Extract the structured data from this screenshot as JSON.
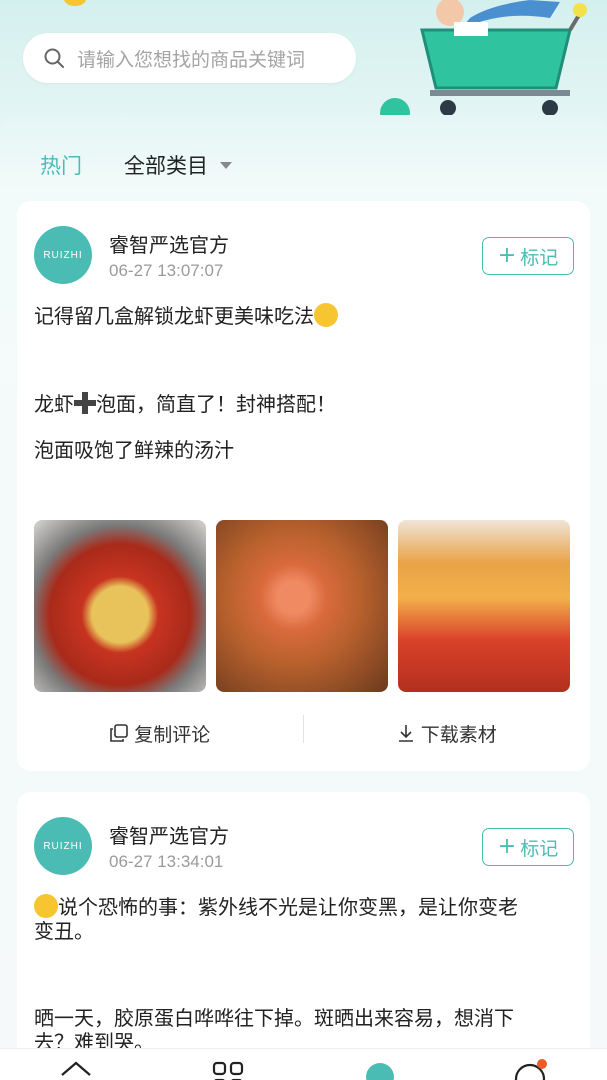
{
  "search": {
    "placeholder": "请输入您想找的商品关键词"
  },
  "tabs": {
    "hot": "热门",
    "category": "全部类目"
  },
  "posts": [
    {
      "author": "睿智严选官方",
      "avatar_text": "RUIZHI",
      "time": "06-27 13:07:07",
      "mark_label": "标记",
      "lines": [
        "记得留几盒解锁龙虾更美味吃法",
        "龙虾",
        "泡面，简直了！封神搭配！",
        "泡面吸饱了鲜辣的汤汁"
      ],
      "copy_label": "复制评论",
      "download_label": "下载素材"
    },
    {
      "author": "睿智严选官方",
      "avatar_text": "RUIZHI",
      "time": "06-27 13:34:01",
      "mark_label": "标记",
      "lines": [
        "说个恐怖的事：紫外线不光是让你变黑，是让你变老",
        "变丑。",
        "晒一天，胶原蛋白哗哗往下掉。斑晒出来容易，想消下",
        "去？难到哭。"
      ]
    }
  ],
  "colors": {
    "accent": "#4bbcb4",
    "bg": "#eaf7f6"
  },
  "icons": [
    "search-icon",
    "caret-down-icon",
    "copy-icon",
    "download-icon",
    "home-icon",
    "grid-icon",
    "planet-icon",
    "message-icon"
  ]
}
